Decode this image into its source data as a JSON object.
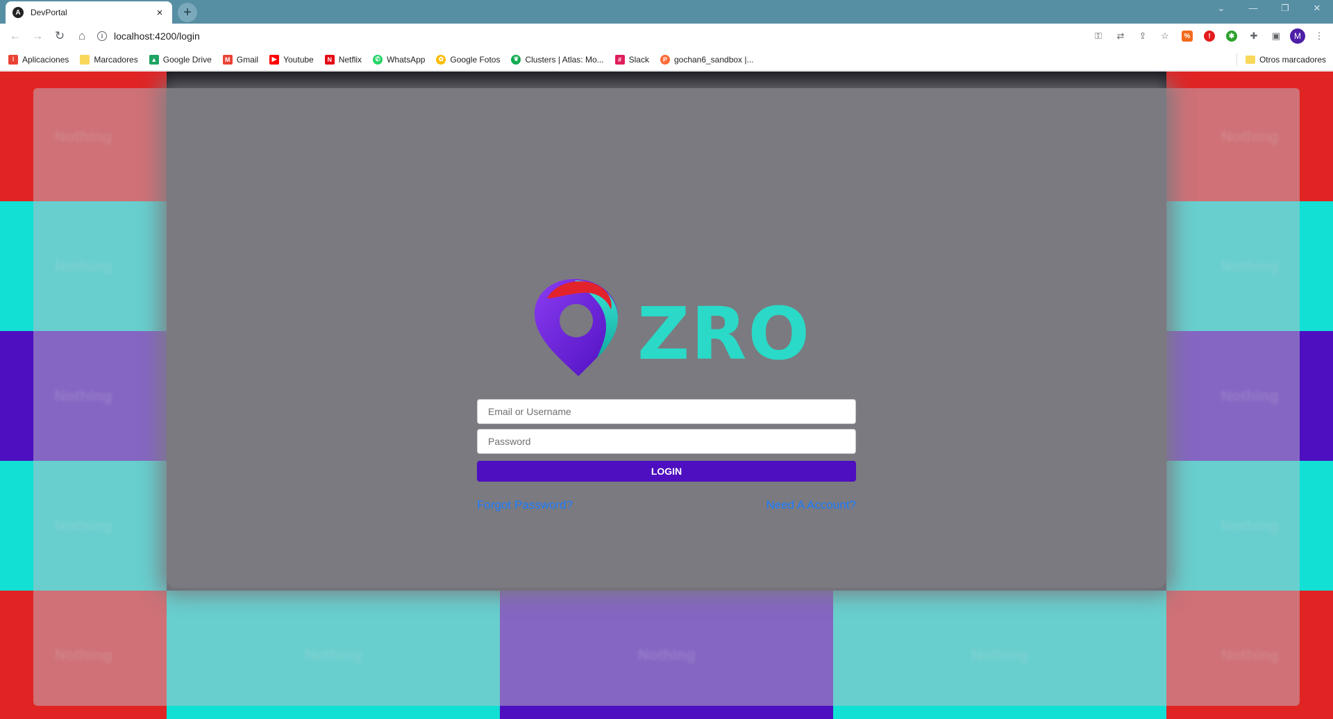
{
  "browser": {
    "tab_title": "DevPortal",
    "tab_close": "×",
    "new_tab": "+",
    "window_controls": [
      "⌄",
      "—",
      "❐",
      "✕"
    ],
    "url": "localhost:4200/login",
    "avatar_letter": "M"
  },
  "bookmarks": [
    {
      "label": "Aplicaciones",
      "icon": "apps-grid-icon",
      "color": "#ea4335"
    },
    {
      "label": "Marcadores",
      "icon": "folder-icon",
      "color": "#f9d75b"
    },
    {
      "label": "Google Drive",
      "icon": "google-drive-icon",
      "color": "#1fa463"
    },
    {
      "label": "Gmail",
      "icon": "gmail-icon",
      "color": "#ea4335"
    },
    {
      "label": "Youtube",
      "icon": "youtube-icon",
      "color": "#ff0000"
    },
    {
      "label": "Netflix",
      "icon": "netflix-icon",
      "color": "#e50914"
    },
    {
      "label": "WhatsApp",
      "icon": "whatsapp-icon",
      "color": "#25d366"
    },
    {
      "label": "Google Fotos",
      "icon": "google-photos-icon",
      "color": "#fbbc04"
    },
    {
      "label": "Clusters | Atlas: Mo...",
      "icon": "mongodb-icon",
      "color": "#13aa52"
    },
    {
      "label": "Slack",
      "icon": "slack-icon",
      "color": "#e01e5a"
    },
    {
      "label": "gochan6_sandbox |...",
      "icon": "postman-icon",
      "color": "#ff6c37"
    }
  ],
  "bookmarks_other": "Otros marcadores",
  "background_tiles": {
    "label": "Nothing",
    "colors": {
      "red": "#e02424",
      "teal": "#12e0d4",
      "purple": "#4d0fbf"
    }
  },
  "login": {
    "brand": "ZRO",
    "email_placeholder": "Email or Username",
    "password_placeholder": "Password",
    "login_label": "LOGIN",
    "forgot_label": "Forgot Password?",
    "signup_label": "Need A Account?"
  },
  "colors": {
    "accent": "#4d0fbf",
    "link": "#1b7cff",
    "brand_teal": "#2ad9c7"
  }
}
